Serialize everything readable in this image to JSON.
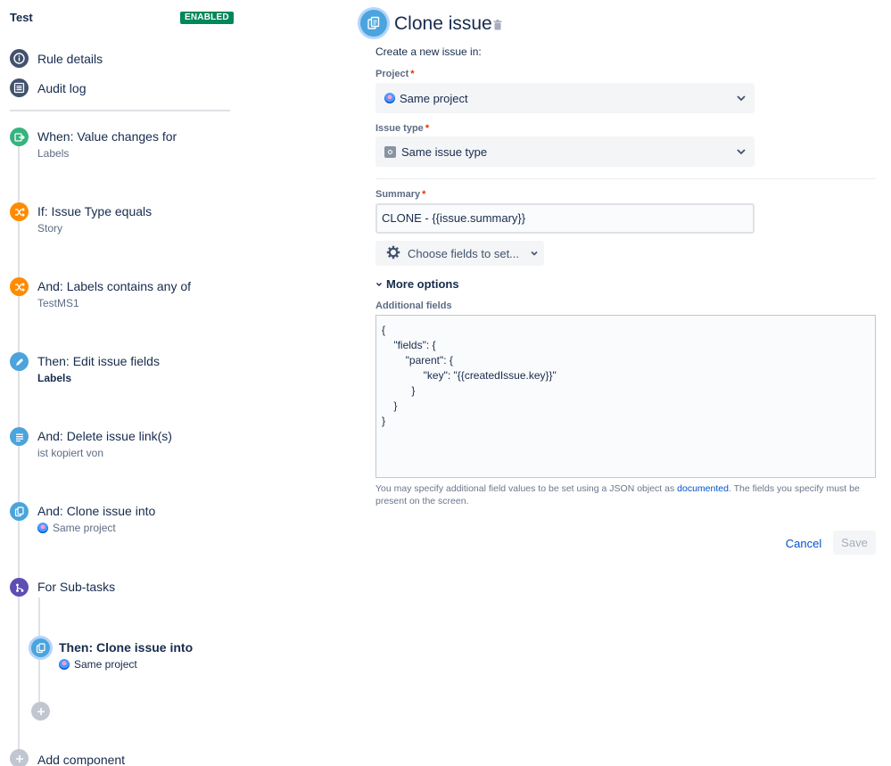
{
  "rule": {
    "title": "Test",
    "status_badge": "ENABLED"
  },
  "nav": {
    "rule_details": "Rule details",
    "audit_log": "Audit log"
  },
  "steps": [
    {
      "title": "When: Value changes for",
      "subtitle": "Labels",
      "icon": "trigger-icon",
      "color": "#36b37e"
    },
    {
      "title": "If: Issue Type equals",
      "subtitle": "Story",
      "icon": "condition-shuffle-icon",
      "color": "#ff8b00"
    },
    {
      "title": "And: Labels contains any of",
      "subtitle": "TestMS1",
      "icon": "condition-shuffle-icon",
      "color": "#ff8b00"
    },
    {
      "title": "Then: Edit issue fields",
      "subtitle": "Labels",
      "icon": "pencil-icon",
      "color": "#4ba4dc"
    },
    {
      "title": "And: Delete issue link(s)",
      "subtitle": "ist kopiert von",
      "icon": "document-lines-icon",
      "color": "#4ba4dc"
    },
    {
      "title": "And: Clone issue into",
      "subtitle": "Same project",
      "icon": "clone-icon",
      "color": "#4ba4dc"
    },
    {
      "title": "For Sub-tasks",
      "subtitle": "",
      "icon": "branch-icon",
      "color": "#5e4db2"
    },
    {
      "title": "Then: Clone issue into",
      "subtitle": "Same project",
      "icon": "clone-icon",
      "color": "#4ba4dc"
    }
  ],
  "add_component": "Add component",
  "editor": {
    "title": "Clone issue",
    "intro": "Create a new issue in:",
    "project_label": "Project",
    "project_value": "Same project",
    "issue_type_label": "Issue type",
    "issue_type_value": "Same issue type",
    "summary_label": "Summary",
    "summary_value": "CLONE - {{issue.summary}}",
    "choose_fields": "Choose fields to set...",
    "more_options": "More options",
    "additional_fields_label": "Additional fields",
    "additional_fields_value": "{\n    \"fields\": {\n        \"parent\": {\n              \"key\": \"{{createdIssue.key}}\"\n          }\n    }\n}",
    "help_before": "You may specify additional field values to be set using a JSON object as ",
    "help_link": "documented",
    "help_after": ". The fields you specify must be present on the screen.",
    "cancel": "Cancel",
    "save": "Save"
  }
}
